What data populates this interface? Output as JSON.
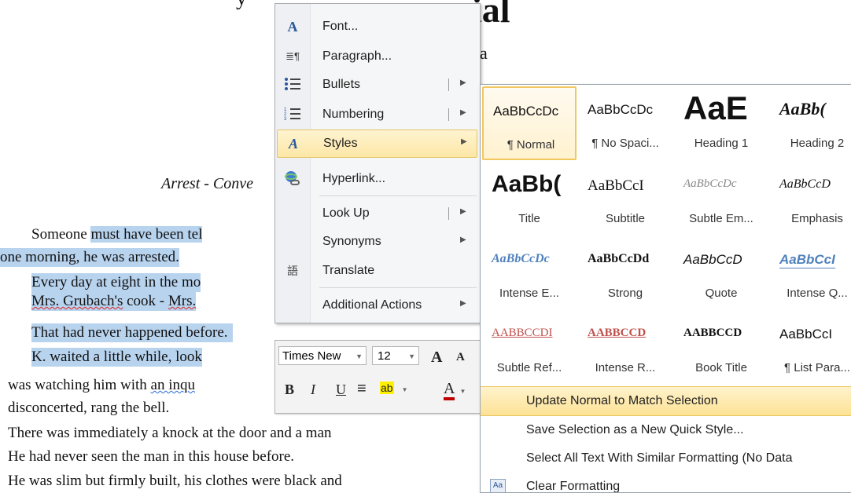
{
  "document": {
    "heading_fragment": "ial",
    "subheading_fragment": "a",
    "title_fragment_top": "y",
    "chapter_fragment": "Arrest - Conve",
    "lines": {
      "l1_pre": "Someone ",
      "l1_hl": "must have been tel",
      "l2": "one morning, he was arrested.",
      "l3": "Every day at eight in the mo",
      "l4_a": "Mrs. Grubach's",
      "l4_b": " cook - ",
      "l4_c": "Mrs.",
      "l5": "That had never happened before.",
      "l6": "K. waited a little while, look",
      "l7_a": "was watching him with ",
      "l7_b": "an inqu",
      "l8": "disconcerted, rang the bell.",
      "l9": "There was immediately a knock at the door and a man",
      "l10": "He had never seen the man in this house before.",
      "l11": "He was slim but firmly built, his clothes were black and"
    }
  },
  "context_menu": {
    "items": [
      {
        "label": "Font...",
        "icon": "A"
      },
      {
        "label": "Paragraph...",
        "icon": "≣¶"
      },
      {
        "label": "Bullets",
        "icon": "☰"
      },
      {
        "label": "Numbering",
        "icon": "☰"
      },
      {
        "label": "Styles",
        "icon": "A"
      },
      {
        "label": "Hyperlink...",
        "icon": "🔗"
      },
      {
        "label": "Look Up",
        "icon": ""
      },
      {
        "label": "Synonyms",
        "icon": ""
      },
      {
        "label": "Translate",
        "icon": "語"
      },
      {
        "label": "Additional Actions",
        "icon": ""
      }
    ]
  },
  "mini_toolbar": {
    "font": "Times New",
    "size": "12",
    "grow": "A",
    "shrink": "A",
    "bold": "B",
    "italic": "I",
    "underline": "U",
    "align": "≡",
    "highlight": "ab",
    "font_color": "A"
  },
  "styles_gallery": {
    "tiles": [
      {
        "preview": "AaBbCcDc",
        "name": "¶ Normal"
      },
      {
        "preview": "AaBbCcDc",
        "name": "¶ No Spaci..."
      },
      {
        "preview": "AaE",
        "name": "Heading 1"
      },
      {
        "preview": "AaBb(",
        "name": "Heading 2"
      },
      {
        "preview": "AaBb(",
        "name": "Title"
      },
      {
        "preview": "AaBbCcI",
        "name": "Subtitle"
      },
      {
        "preview": "AaBbCcDc",
        "name": "Subtle Em..."
      },
      {
        "preview": "AaBbCcD",
        "name": "Emphasis"
      },
      {
        "preview": "AaBbCcDc",
        "name": "Intense E..."
      },
      {
        "preview": "AaBbCcDd",
        "name": "Strong"
      },
      {
        "preview": "AaBbCcD",
        "name": "Quote"
      },
      {
        "preview": "AaBbCcI",
        "name": "Intense Q..."
      },
      {
        "preview": "AABBCCDI",
        "name": "Subtle Ref..."
      },
      {
        "preview": "AABBCCD",
        "name": "Intense R..."
      },
      {
        "preview": "AABBCCD",
        "name": "Book Title"
      },
      {
        "preview": "AaBbCcI",
        "name": "¶ List Para..."
      }
    ],
    "commands": [
      {
        "label": "Update Normal to Match Selection"
      },
      {
        "label": "Save Selection as a New Quick Style..."
      },
      {
        "label": "Select All Text With Similar Formatting (No Data"
      },
      {
        "label": "Clear Formatting"
      }
    ]
  },
  "colors": {
    "selection": "#b8d3ee",
    "hover": "#fde7a6",
    "accent": "#2b579a"
  }
}
